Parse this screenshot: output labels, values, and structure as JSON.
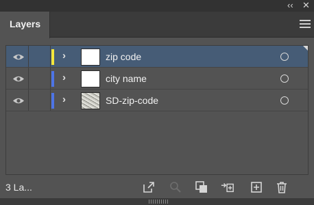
{
  "panel": {
    "tab_label": "Layers",
    "collapse_icon": "double-chevron-left",
    "close_icon": "close-x",
    "menu_icon": "hamburger-menu"
  },
  "layers": [
    {
      "name": "zip code",
      "color": "#f5e63b",
      "thumbnail": "blank",
      "selected": true
    },
    {
      "name": "city name",
      "color": "#4d74e6",
      "thumbnail": "blank",
      "selected": false
    },
    {
      "name": "SD-zip-code",
      "color": "#4d74e6",
      "thumbnail": "textured-image",
      "selected": false
    }
  ],
  "footer": {
    "count_label": "3 La...",
    "icons": [
      "export-icon",
      "locate-object-icon",
      "make-clipping-mask-icon",
      "move-to-layer-icon",
      "new-layer-icon",
      "trash-icon"
    ]
  },
  "colors": {
    "panel_bg": "#535353",
    "selection": "#465c76",
    "tabbar": "#3b3b3b"
  }
}
